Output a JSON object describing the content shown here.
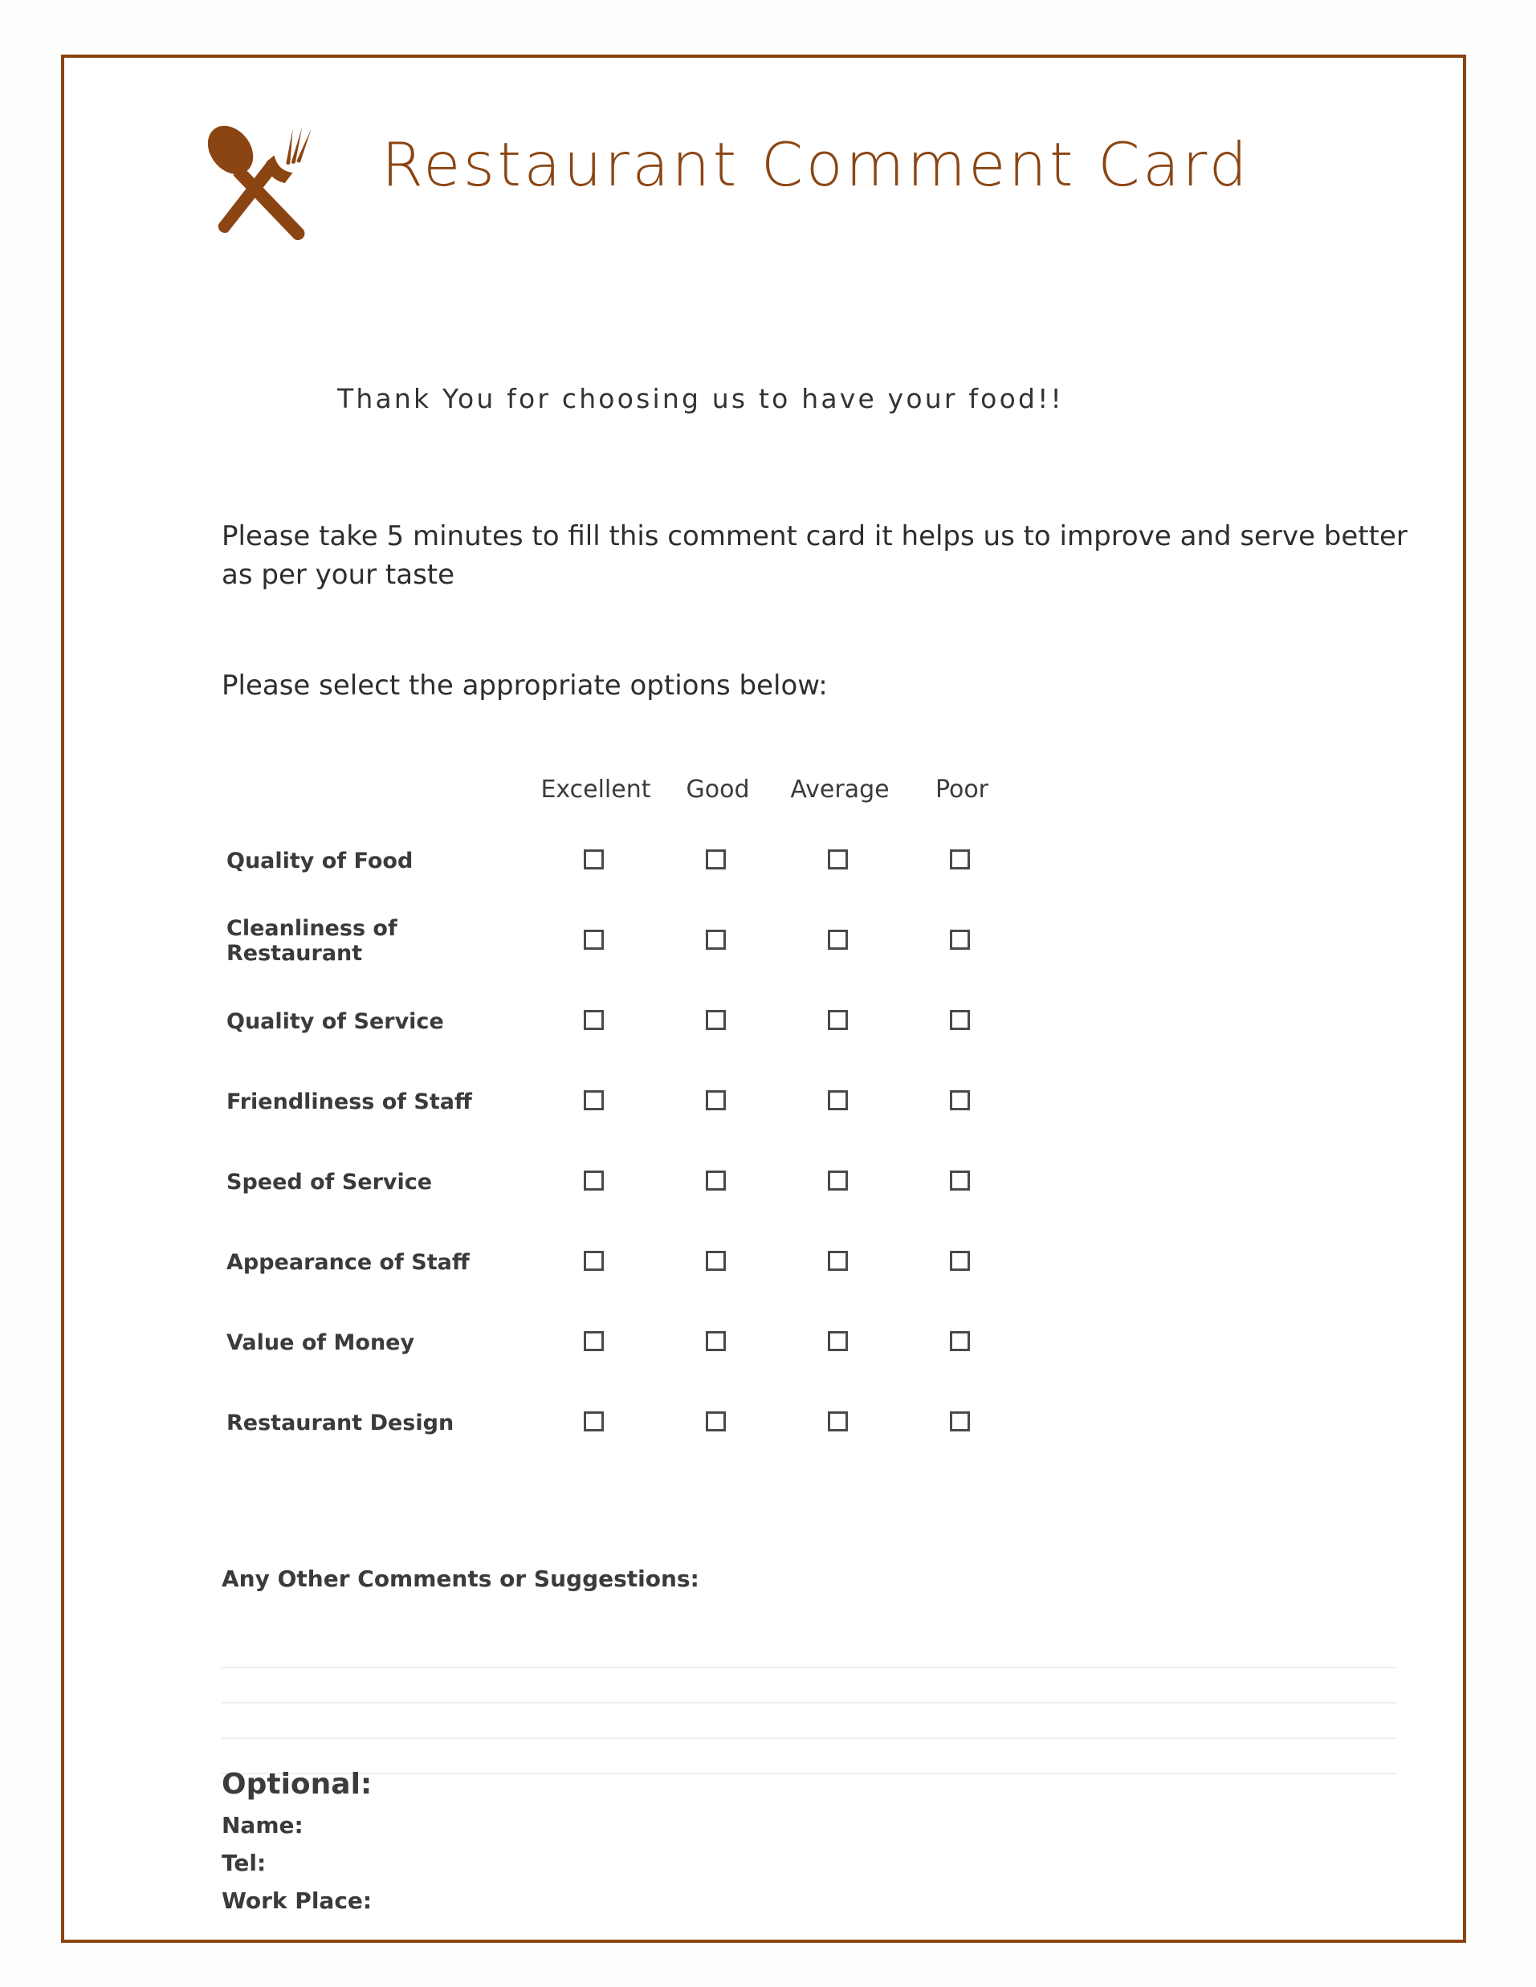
{
  "card": {
    "border_color": "#8B4513",
    "background": "#ffffff"
  },
  "header": {
    "icon_name": "crossed-spoon-fork-icon",
    "title": "Restaurant Comment Card",
    "title_color": "#8B4513"
  },
  "intro": {
    "thanks": "Thank You for choosing us to have your food!!",
    "paragraph_1": "Please take 5 minutes to fill this comment card it helps us to improve and serve better as per your taste",
    "paragraph_2": "Please select the appropriate options below:"
  },
  "rating_table": {
    "columns": [
      "Excellent",
      "Good",
      "Average",
      "Poor"
    ],
    "rows": [
      {
        "label": "Quality of Food"
      },
      {
        "label": "Cleanliness of Restaurant"
      },
      {
        "label": "Quality of Service"
      },
      {
        "label": "Friendliness of Staff"
      },
      {
        "label": "Speed of Service"
      },
      {
        "label": "Appearance of Staff"
      },
      {
        "label": "Value of Money"
      },
      {
        "label": "Restaurant Design"
      }
    ]
  },
  "comments": {
    "heading": "Any Other Comments or Suggestions:",
    "line_count": 4
  },
  "optional": {
    "heading": "Optional:",
    "fields": [
      {
        "label": "Name:"
      },
      {
        "label": "Tel:"
      },
      {
        "label": "Work Place:"
      }
    ]
  }
}
